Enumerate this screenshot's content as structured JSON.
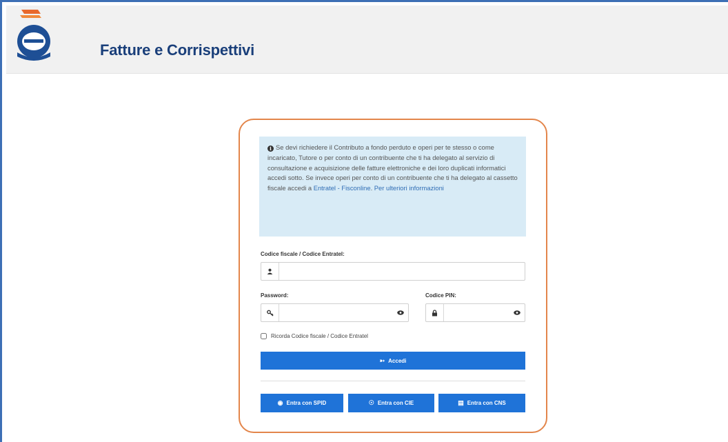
{
  "header": {
    "app_title": "Fatture e Corrispettivi",
    "logo_icon": "agenzia-entrate-logo-icon"
  },
  "info": {
    "icon": "info-circle-icon",
    "text": "Se devi richiedere il Contributo a fondo perduto e operi per te stesso o come incaricato, Tutore o per conto di un contribuente che ti ha delegato al servizio di consultazione e acquisizione delle fatture elettroniche e dei loro duplicati informatici accedi sotto. Se invece operi per conto di un contribuente che ti ha delegato al cassetto fiscale accedi a ",
    "link_entratel": "Entratel - Fisconline",
    "separator": ". ",
    "link_more": "Per ulteriori informazioni"
  },
  "form": {
    "codice_label": "Codice fiscale / Codice Entratel:",
    "codice_value": "",
    "password_label": "Password:",
    "password_value": "",
    "pin_label": "Codice PIN:",
    "pin_value": "",
    "remember_label": "Ricorda Codice fiscale / Codice Entratel",
    "remember_checked": false,
    "submit_label": "Accedi"
  },
  "alt_login": {
    "spid_label": "Entra con SPID",
    "cie_label": "Entra con CIE",
    "cns_label": "Entra con CNS"
  },
  "colors": {
    "primary": "#1f73d8",
    "brand_title": "#1a3f7a",
    "card_border": "#e3854a",
    "info_bg": "#d8ebf6"
  }
}
